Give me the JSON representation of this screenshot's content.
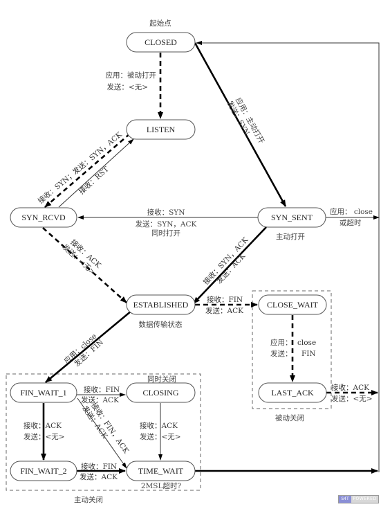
{
  "diagram": {
    "title_note": "起始点",
    "states": {
      "closed": "CLOSED",
      "listen": "LISTEN",
      "syn_rcvd": "SYN_RCVD",
      "syn_sent": "SYN_SENT",
      "established": "ESTABLISHED",
      "close_wait": "CLOSE_WAIT",
      "last_ack": "LAST_ACK",
      "fin_wait_1": "FIN_WAIT_1",
      "closing": "CLOSING",
      "fin_wait_2": "FIN_WAIT_2",
      "time_wait": "TIME_WAIT"
    },
    "notes": {
      "syn_sent": "主动打开",
      "simultaneous_open": "同时打开",
      "established": "数据传输状态",
      "simultaneous_close": "同时关闭",
      "passive_close": "被动关闭",
      "active_close": "主动关闭",
      "time_wait": "2MSL超时?"
    },
    "transitions": {
      "closed_listen": [
        "应用：被动打开",
        "发送：<无>"
      ],
      "closed_syn_sent": [
        "应用：主动打开",
        "发送：SYN"
      ],
      "listen_syn_rcvd": "接收：SYN；发送：SYN，ACK",
      "syn_rcvd_listen": "接收：RST",
      "syn_sent_syn_rcvd": [
        "接收：SYN",
        "发送：SYN，ACK"
      ],
      "syn_sent_closed": [
        "应用： close",
        "或超时"
      ],
      "syn_rcvd_established": [
        "接收：ACK",
        "发送：<无>"
      ],
      "syn_sent_established": [
        "接收：SYN，ACK",
        "发送：ACK"
      ],
      "established_close_wait": [
        "接收：FIN",
        "发送：ACK"
      ],
      "close_wait_last_ack": [
        "应用：",
        "close",
        "发送：",
        "FIN"
      ],
      "last_ack_closed": [
        "接收：ACK",
        "发送：<无>"
      ],
      "established_fin_wait_1": [
        "应用：close",
        "发送：FIN"
      ],
      "fin_wait_1_closing": [
        "接收：FIN",
        "发送：ACK"
      ],
      "fin_wait_1_fin_wait_2": [
        "接收：ACK",
        "发送：<无>"
      ],
      "fin_wait_1_time_wait": [
        "接收：FIN，ACK",
        "发送：ACK"
      ],
      "closing_time_wait": [
        "接收：ACK",
        "发送：<无>"
      ],
      "fin_wait_2_time_wait": [
        "接收：FIN",
        "发送：ACK"
      ]
    },
    "badge": [
      "S4T",
      "POWERED"
    ]
  }
}
